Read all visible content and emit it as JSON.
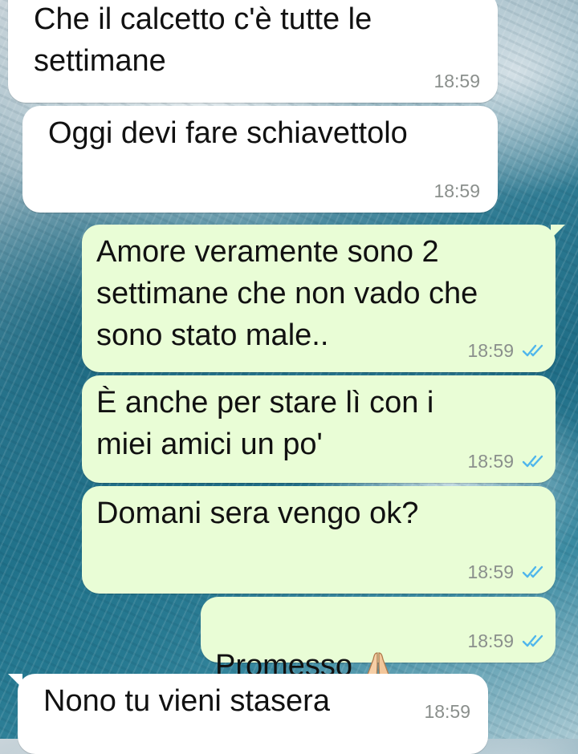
{
  "chat": {
    "messages": [
      {
        "direction": "incoming",
        "text": "Che il calcetto c'è tutte le\nsettimane",
        "time": "18:59"
      },
      {
        "direction": "incoming",
        "text": "Oggi devi fare schiavettolo",
        "time": "18:59"
      },
      {
        "direction": "outgoing",
        "text": "Amore veramente sono 2\nsettimane che non vado che\nsono stato male..",
        "time": "18:59",
        "status": "read"
      },
      {
        "direction": "outgoing",
        "text": "È anche per stare lì con i\nmiei amici un po'",
        "time": "18:59",
        "status": "read"
      },
      {
        "direction": "outgoing",
        "text": "Domani sera vengo ok?",
        "time": "18:59",
        "status": "read"
      },
      {
        "direction": "outgoing",
        "text": "Promesso",
        "emoji": "folded-hands",
        "time": "18:59",
        "status": "read"
      },
      {
        "direction": "incoming",
        "text": "Nono tu vieni stasera",
        "time": "18:59"
      }
    ]
  },
  "colors": {
    "incoming_bubble": "#ffffff",
    "outgoing_bubble": "#e9fdd6",
    "read_ticks": "#4fb6ec",
    "timestamp": "#8a8f8c"
  },
  "icons": {
    "read_receipt": "double-check-icon",
    "emoji": "folded-hands-icon"
  }
}
